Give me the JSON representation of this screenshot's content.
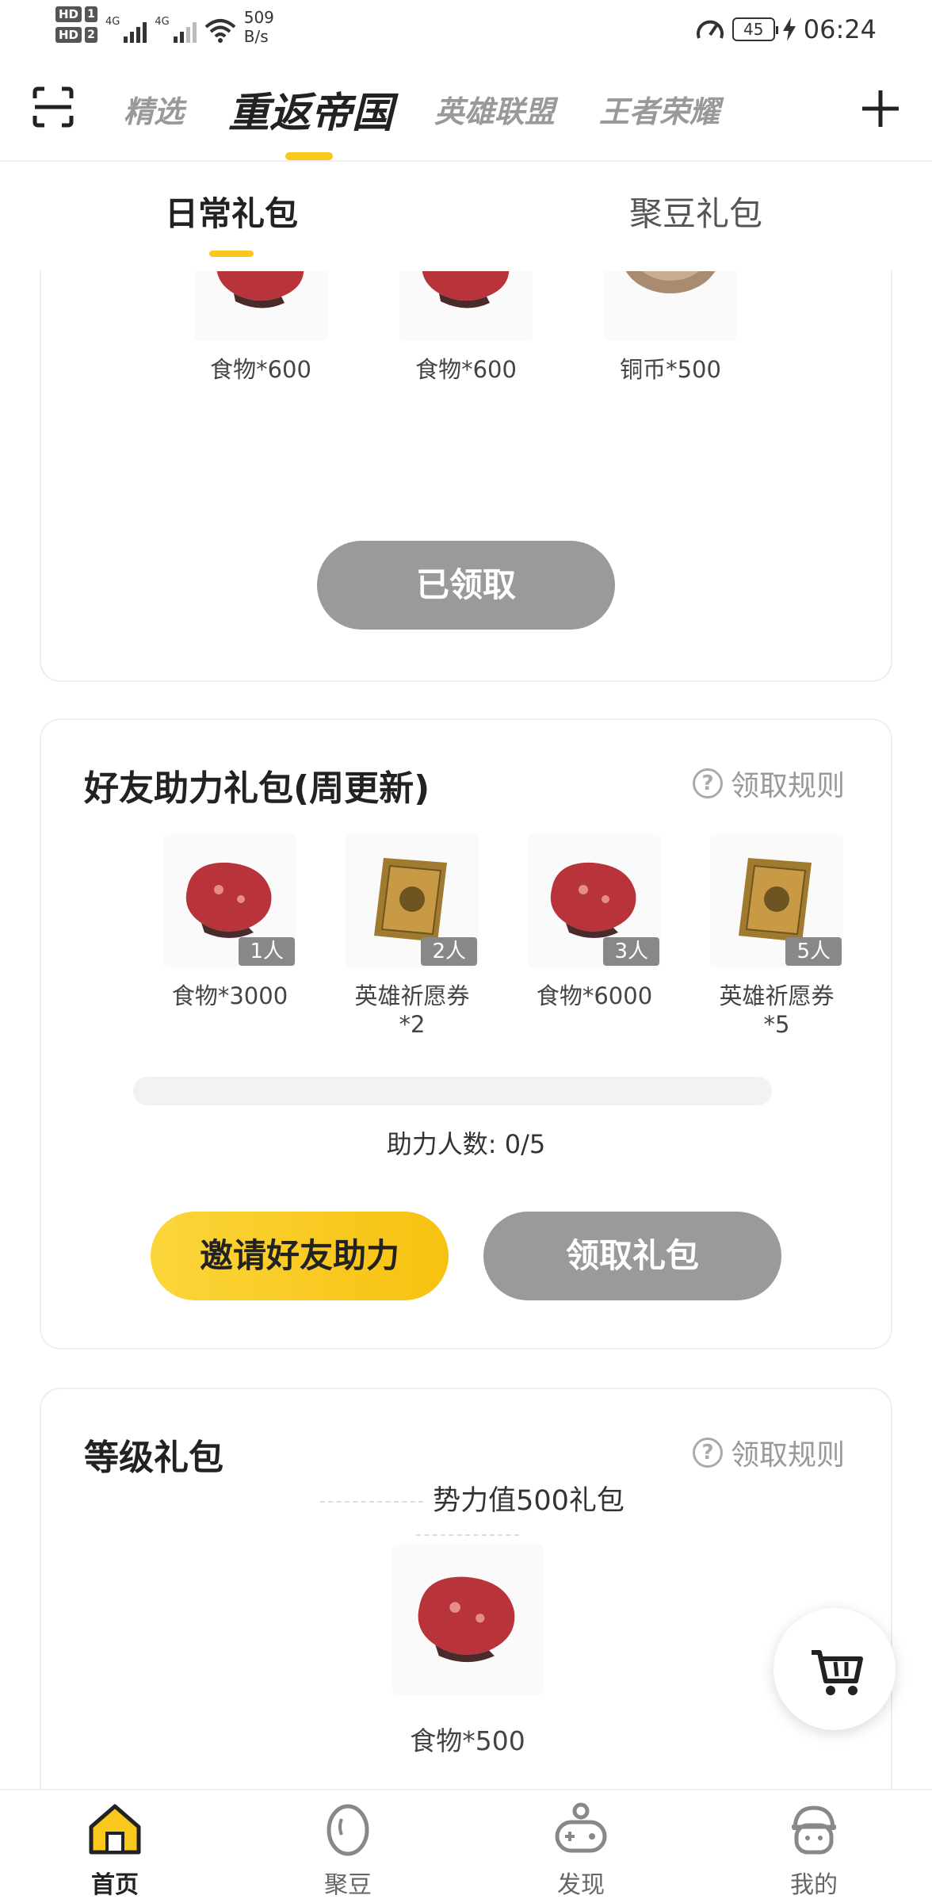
{
  "status_bar": {
    "hd1": "HD",
    "hd1_num": "1",
    "hd2": "HD",
    "hd2_num": "2",
    "net1": "4G",
    "net2": "4G",
    "speed_value": "509",
    "speed_unit": "B/s",
    "battery": "45",
    "time": "06:24"
  },
  "top_tabs": [
    "精选",
    "重返帝国",
    "英雄联盟",
    "王者荣耀"
  ],
  "sub_tabs": [
    "日常礼包",
    "聚豆礼包"
  ],
  "daily_card": {
    "items": [
      "食物*600",
      "食物*600",
      "铜币*500"
    ],
    "button": "已领取"
  },
  "friend_card": {
    "title": "好友助力礼包(周更新)",
    "rule_link": "领取规则",
    "rewards": [
      {
        "label": "食物*3000",
        "badge": "1人",
        "icon": "meat-icon"
      },
      {
        "label": "英雄祈愿券\n*2",
        "badge": "2人",
        "icon": "wish-ticket-icon"
      },
      {
        "label": "食物*6000",
        "badge": "3人",
        "icon": "meat-icon"
      },
      {
        "label": "英雄祈愿券\n*5",
        "badge": "5人",
        "icon": "wish-ticket-icon"
      }
    ],
    "progress_fraction": 0,
    "helpers_text": "助力人数: 0/5",
    "invite_button": "邀请好友助力",
    "claim_button": "领取礼包"
  },
  "level_card": {
    "title": "等级礼包",
    "rule_link": "领取规则",
    "subheading": "势力值500礼包",
    "item_label": "食物*500"
  },
  "bottom_nav": [
    "首页",
    "聚豆",
    "发现",
    "我的"
  ],
  "colors": {
    "accent": "#f8c81c",
    "button_gray": "#9a9a9a"
  }
}
